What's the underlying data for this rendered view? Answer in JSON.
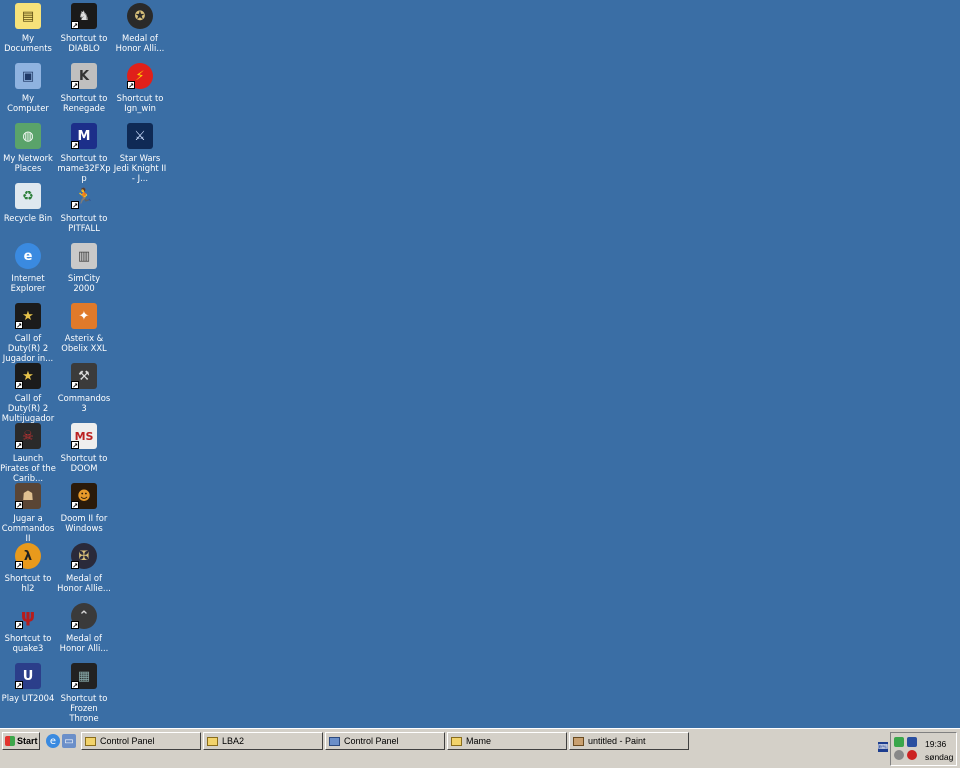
{
  "desktop": {
    "background_color": "#3a6ea5",
    "icons": [
      {
        "label": "My Documents",
        "icon": "my-documents-icon"
      },
      {
        "label": "Shortcut to DIABLO",
        "icon": "diablo-icon"
      },
      {
        "label": "Medal of Honor Alli...",
        "icon": "medal-of-honor-icon"
      },
      {
        "label": "My Computer",
        "icon": "my-computer-icon"
      },
      {
        "label": "Shortcut to Renegade",
        "icon": "renegade-icon"
      },
      {
        "label": "Shortcut to Ign_win",
        "icon": "ign-win-icon"
      },
      {
        "label": "My Network Places",
        "icon": "network-places-icon"
      },
      {
        "label": "Shortcut to mame32FXpp",
        "icon": "mame-icon"
      },
      {
        "label": "Star Wars Jedi Knight II - J...",
        "icon": "jedi-knight-icon"
      },
      {
        "label": "Recycle Bin",
        "icon": "recycle-bin-icon"
      },
      {
        "label": "Shortcut to PITFALL",
        "icon": "pitfall-icon"
      },
      {
        "label": "Internet Explorer",
        "icon": "internet-explorer-icon"
      },
      {
        "label": "SimCity 2000",
        "icon": "simcity-icon"
      },
      {
        "label": "Call of Duty(R) 2 Jugador in...",
        "icon": "call-of-duty-icon"
      },
      {
        "label": "Asterix & Obelix XXL",
        "icon": "asterix-icon"
      },
      {
        "label": "Call of Duty(R) 2 Multijugador",
        "icon": "call-of-duty-multi-icon"
      },
      {
        "label": "Commandos 3",
        "icon": "commandos-icon"
      },
      {
        "label": "Launch Pirates of the Carib...",
        "icon": "pirates-icon"
      },
      {
        "label": "Shortcut to DOOM",
        "icon": "doom-icon"
      },
      {
        "label": "Jugar a Commandos II",
        "icon": "commandos2-icon"
      },
      {
        "label": "Doom II for Windows",
        "icon": "doom2-icon"
      },
      {
        "label": "Shortcut to hl2",
        "icon": "half-life-icon"
      },
      {
        "label": "Medal of Honor Allie...",
        "icon": "medal-of-honor-2-icon"
      },
      {
        "label": "Shortcut to quake3",
        "icon": "quake-icon"
      },
      {
        "label": "Medal of Honor Alli...",
        "icon": "medal-of-honor-3-icon"
      },
      {
        "label": "Play UT2004",
        "icon": "ut2004-icon"
      },
      {
        "label": "Shortcut to Frozen Throne",
        "icon": "frozen-throne-icon"
      }
    ]
  },
  "taskbar": {
    "start_label": "Start",
    "quick_launch": [
      {
        "icon": "ie-quicklaunch-icon"
      },
      {
        "icon": "show-desktop-icon"
      }
    ],
    "tasks": [
      {
        "label": "Control Panel"
      },
      {
        "label": "LBA2"
      },
      {
        "label": "Control Panel"
      },
      {
        "label": "Mame"
      },
      {
        "label": "untitled - Paint"
      }
    ],
    "tray": {
      "time": "19:36",
      "day": "søndag"
    }
  }
}
